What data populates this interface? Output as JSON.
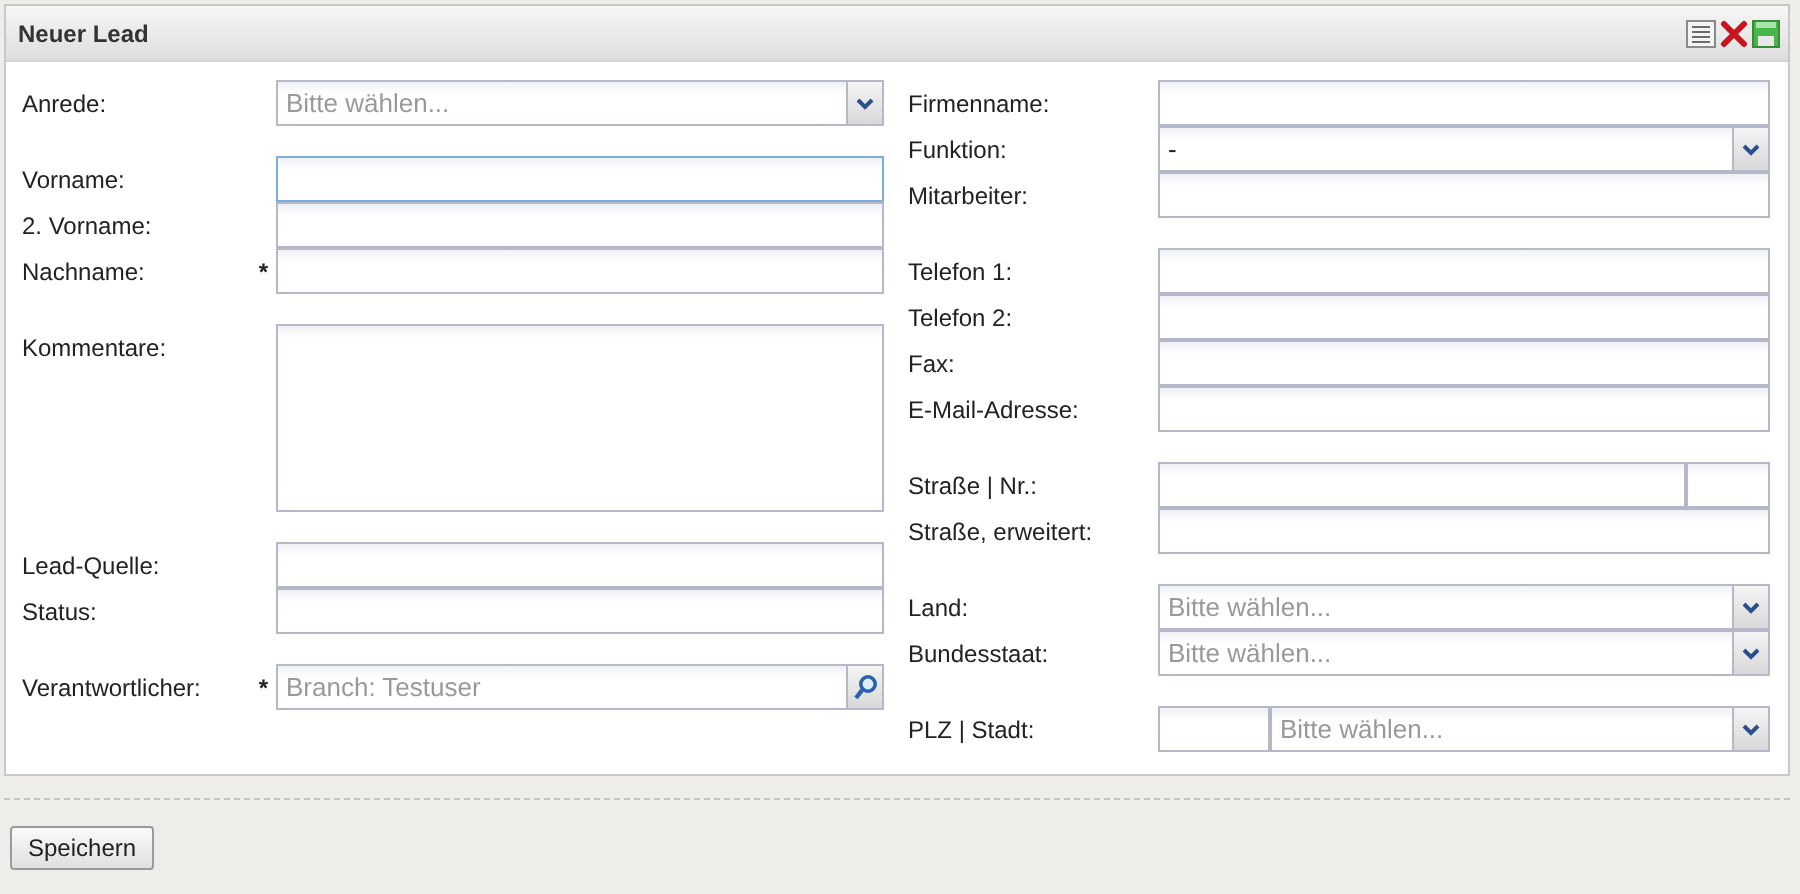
{
  "panel": {
    "title": "Neuer Lead",
    "tools": [
      {
        "kind": "list"
      },
      {
        "kind": "close"
      },
      {
        "kind": "save"
      }
    ]
  },
  "left_column": [
    [
      {
        "label": "Anrede:",
        "kind": "select",
        "placeholder": "Bitte wählen...",
        "focused": false
      }
    ],
    [
      {
        "label": "Vorname:",
        "kind": "text",
        "focused": true
      },
      {
        "label": "2. Vorname:",
        "kind": "text",
        "focused": false
      },
      {
        "label": "Nachname:",
        "mark": "*",
        "kind": "text",
        "focused": false
      }
    ],
    [
      {
        "label": "Kommentare:",
        "kind": "textarea",
        "focused": false
      }
    ],
    [
      {
        "label": "Lead-Quelle:",
        "kind": "text",
        "focused": false
      },
      {
        "label": "Status:",
        "kind": "text",
        "focused": false
      }
    ],
    [
      {
        "label": "Verantwortlicher:",
        "mark": "*",
        "kind": "lookup",
        "placeholder": "Branch: Testuser",
        "focused": false
      }
    ]
  ],
  "right_column": [
    [
      {
        "label": "Firmenname:",
        "kind": "text",
        "focused": false
      },
      {
        "label": "Funktion:",
        "kind": "select",
        "value": "-",
        "focused": false
      },
      {
        "label": "Mitarbeiter:",
        "kind": "text",
        "focused": false
      }
    ],
    [
      {
        "label": "Telefon 1:",
        "kind": "text",
        "focused": false
      },
      {
        "label": "Telefon 2:",
        "kind": "text",
        "focused": false
      },
      {
        "label": "Fax:",
        "kind": "text",
        "focused": false
      },
      {
        "label": "E-Mail-Adresse:",
        "kind": "text",
        "focused": false
      }
    ],
    [
      {
        "label": "Straße | Nr.:",
        "kind": "split_text",
        "focused": false
      },
      {
        "label": "Straße, erweitert:",
        "kind": "text",
        "focused": false
      }
    ],
    [
      {
        "label": "Land:",
        "kind": "select",
        "placeholder": "Bitte wählen...",
        "focused": false
      },
      {
        "label": "Bundesstaat:",
        "kind": "select",
        "placeholder": "Bitte wählen...",
        "focused": false
      }
    ],
    [
      {
        "label": "PLZ | Stadt:",
        "kind": "split_select",
        "placeholder": "Bitte wählen...",
        "focused": false
      }
    ]
  ],
  "buttons": [
    {
      "label": "Speichern"
    }
  ]
}
